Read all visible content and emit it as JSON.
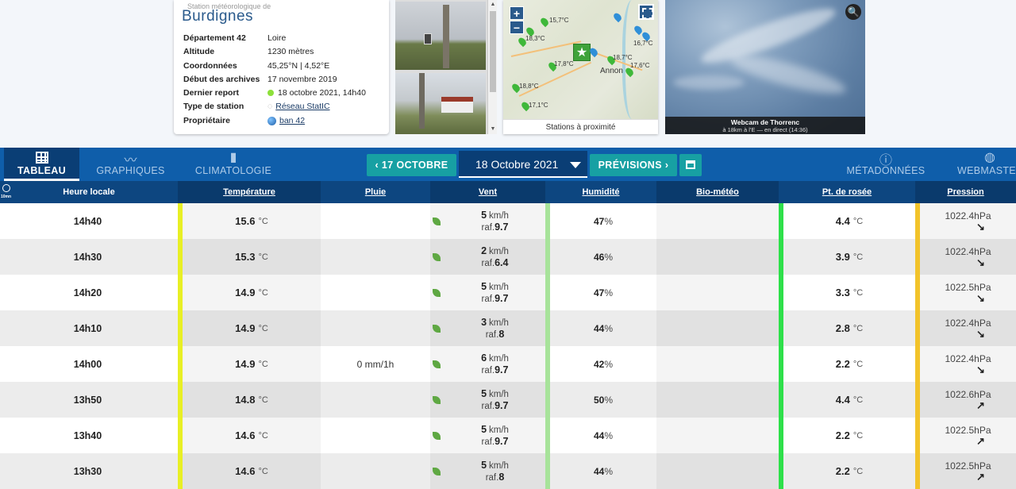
{
  "station": {
    "subtitle": "Station météorologique de",
    "name": "Burdignes",
    "rows": [
      {
        "key": "Département 42",
        "value": "Loire"
      },
      {
        "key": "Altitude",
        "value": "1230 mètres"
      },
      {
        "key": "Coordonnées",
        "value": "45,25°N | 4,52°E"
      },
      {
        "key": "Début des archives",
        "value": "17 novembre 2019"
      },
      {
        "key": "Dernier report",
        "value": "18 octobre 2021, 14h40"
      },
      {
        "key": "Type de station",
        "value": "Réseau StatIC"
      },
      {
        "key": "Propriétaire",
        "value": "ban 42"
      }
    ]
  },
  "map": {
    "zoom_in": "+",
    "zoom_out": "−",
    "caption": "Stations à proximité",
    "labels": [
      "15,7°C",
      "18,3°C",
      "17,8°C",
      "18,8°C",
      "17,1°C",
      "18,7°C",
      "17,6°C",
      "16,7°C",
      "Annon"
    ]
  },
  "webcam": {
    "title": "Webcam de Thorrenc",
    "subtitle": "à 18km à l'E — en direct (14:36)"
  },
  "nav": {
    "tabs": [
      {
        "label": "TABLEAU"
      },
      {
        "label": "GRAPHIQUES"
      },
      {
        "label": "CLIMATOLOGIE"
      },
      {
        "label": "MÉTADONNÉES"
      },
      {
        "label": "WEBMASTER"
      }
    ],
    "prev_label": "‹ 17 OCTOBRE",
    "date_label": "18 Octobre 2021",
    "next_label": "PRÉVISIONS ›"
  },
  "table": {
    "clock_label": "10mn",
    "headers": {
      "time": "Heure locale",
      "temp": "Température",
      "rain": "Pluie",
      "wind": "Vent",
      "hum": "Humidité",
      "bio": "Bio-météo",
      "dew": "Pt. de rosée",
      "pres": "Pression"
    },
    "units": {
      "temp": "°C",
      "wind": "km/h",
      "gust": "raf.",
      "hum": "%",
      "pres": "hPa"
    },
    "rows": [
      {
        "time": "14h40",
        "temp": "15.6",
        "rain": "",
        "wind": "5",
        "gust": "9.7",
        "hum": "47",
        "dew": "4.4",
        "pres": "1022.4",
        "trend": "↘"
      },
      {
        "time": "14h30",
        "temp": "15.3",
        "rain": "",
        "wind": "2",
        "gust": "6.4",
        "hum": "46",
        "dew": "3.9",
        "pres": "1022.4",
        "trend": "↘"
      },
      {
        "time": "14h20",
        "temp": "14.9",
        "rain": "",
        "wind": "5",
        "gust": "9.7",
        "hum": "47",
        "dew": "3.3",
        "pres": "1022.5",
        "trend": "↘"
      },
      {
        "time": "14h10",
        "temp": "14.9",
        "rain": "",
        "wind": "3",
        "gust": "8",
        "hum": "44",
        "dew": "2.8",
        "pres": "1022.4",
        "trend": "↘"
      },
      {
        "time": "14h00",
        "temp": "14.9",
        "rain": "0 mm/1h",
        "wind": "6",
        "gust": "9.7",
        "hum": "42",
        "dew": "2.2",
        "pres": "1022.4",
        "trend": "↘"
      },
      {
        "time": "13h50",
        "temp": "14.8",
        "rain": "",
        "wind": "5",
        "gust": "9.7",
        "hum": "50",
        "dew": "4.4",
        "pres": "1022.6",
        "trend": "↗"
      },
      {
        "time": "13h40",
        "temp": "14.6",
        "rain": "",
        "wind": "5",
        "gust": "9.7",
        "hum": "44",
        "dew": "2.2",
        "pres": "1022.5",
        "trend": "↗"
      },
      {
        "time": "13h30",
        "temp": "14.6",
        "rain": "",
        "wind": "5",
        "gust": "8",
        "hum": "44",
        "dew": "2.2",
        "pres": "1022.5",
        "trend": "↗"
      }
    ]
  },
  "colors": {
    "nav_bg": "#0f5eaa",
    "header_bg": "#0d4680",
    "accent_teal": "#17a0a3",
    "temp_bar": "#e8ef25",
    "hum_bar": "#a7e39a",
    "dew_bar": "#2ee04a",
    "pres_bar": "#f2c32a"
  }
}
